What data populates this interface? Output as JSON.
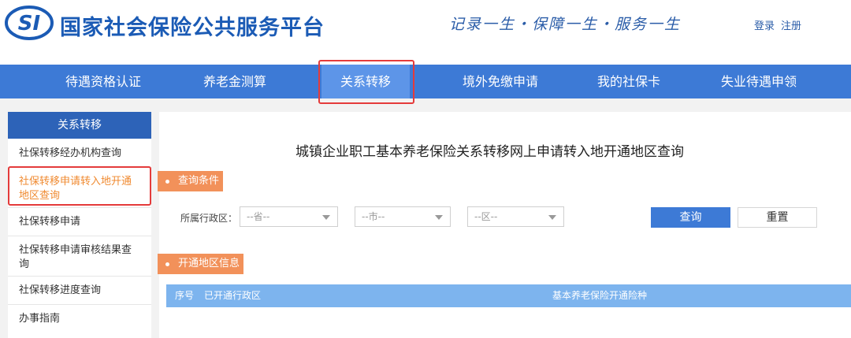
{
  "header": {
    "logo_text": "SI",
    "site_title": "国家社会保险公共服务平台",
    "slogan": "记录一生・保障一生・服务一生",
    "login_label": "登录",
    "register_label": "注册"
  },
  "nav": {
    "items": [
      {
        "label": "待遇资格认证"
      },
      {
        "label": "养老金测算"
      },
      {
        "label": "关系转移"
      },
      {
        "label": "境外免缴申请"
      },
      {
        "label": "我的社保卡"
      },
      {
        "label": "失业待遇申领"
      }
    ],
    "active_index": 2
  },
  "sidebar": {
    "title": "关系转移",
    "items": [
      {
        "label": "社保转移经办机构查询"
      },
      {
        "label": "社保转移申请转入地开通地区查询"
      },
      {
        "label": "社保转移申请"
      },
      {
        "label": "社保转移申请审核结果查询"
      },
      {
        "label": "社保转移进度查询"
      },
      {
        "label": "办事指南"
      }
    ],
    "active_index": 1
  },
  "main": {
    "page_title": "城镇企业职工基本养老保险关系转移网上申请转入地开通地区查询",
    "query_section_label": "查询条件",
    "region_label": "所属行政区：",
    "province_select": "--省--",
    "city_select": "--市--",
    "district_select": "--区--",
    "query_button": "查询",
    "reset_button": "重置",
    "result_section_label": "开通地区信息",
    "table": {
      "columns": [
        "序号",
        "已开通行政区",
        "基本养老保险开通险种"
      ]
    }
  },
  "colors": {
    "brand_blue": "#1b5bb5",
    "nav_blue": "#3d7ad6",
    "accent_orange": "#f2915a",
    "highlight_red": "#e43b3b"
  }
}
